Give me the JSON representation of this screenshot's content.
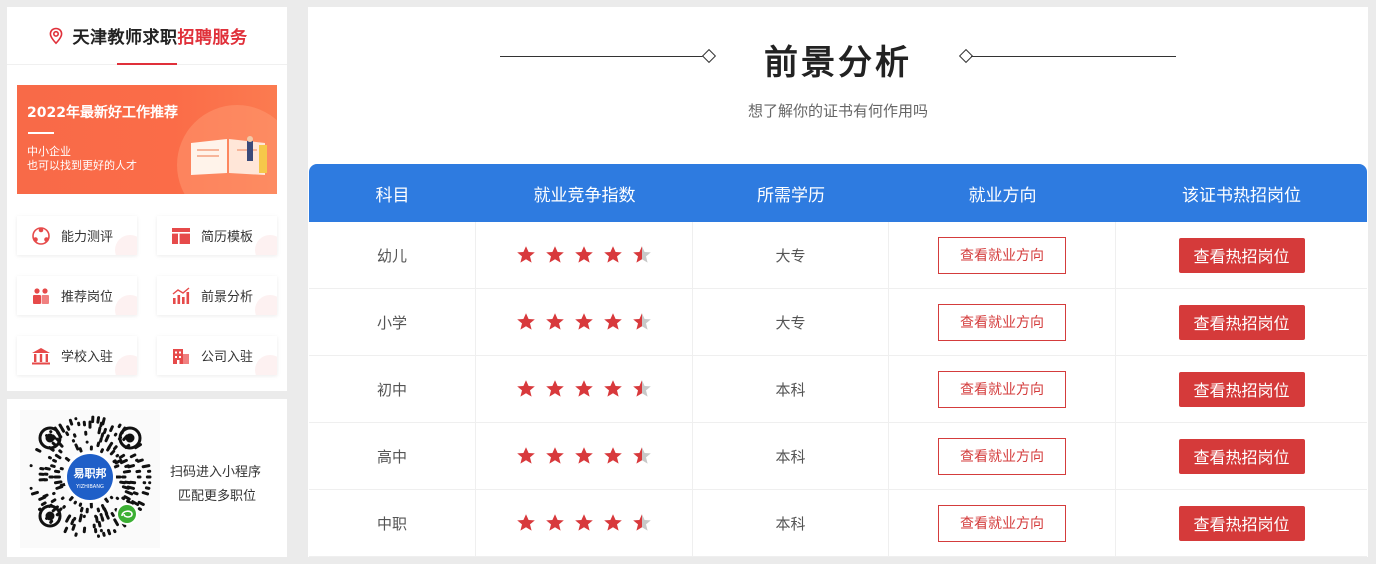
{
  "sidebar": {
    "title_main": "天津教师求职",
    "title_highlight": "招聘服务",
    "banner": {
      "title": "2022年最新好工作推荐",
      "sub1": "中小企业",
      "sub2": "也可以找到更好的人才"
    },
    "buttons": [
      {
        "label": "能力测评",
        "icon": "ability-test-icon"
      },
      {
        "label": "简历模板",
        "icon": "resume-template-icon"
      },
      {
        "label": "推荐岗位",
        "icon": "recommend-job-icon"
      },
      {
        "label": "前景分析",
        "icon": "prospect-chart-icon"
      },
      {
        "label": "学校入驻",
        "icon": "school-icon"
      },
      {
        "label": "公司入驻",
        "icon": "company-icon"
      }
    ],
    "qr": {
      "logo_text": "易职邦",
      "logo_sub": "YIZHIBANG",
      "line1": "扫码进入小程序",
      "line2": "匹配更多职位"
    }
  },
  "main": {
    "title": "前景分析",
    "subtitle": "想了解你的证书有何作用吗",
    "table": {
      "headers": [
        "科目",
        "就业竞争指数",
        "所需学历",
        "就业方向",
        "该证书热招岗位"
      ],
      "rows": [
        {
          "subject": "幼儿",
          "stars": 4.5,
          "education": "大专",
          "direction_btn": "查看就业方向",
          "jobs_btn": "查看热招岗位"
        },
        {
          "subject": "小学",
          "stars": 4.5,
          "education": "大专",
          "direction_btn": "查看就业方向",
          "jobs_btn": "查看热招岗位"
        },
        {
          "subject": "初中",
          "stars": 4.5,
          "education": "本科",
          "direction_btn": "查看就业方向",
          "jobs_btn": "查看热招岗位"
        },
        {
          "subject": "高中",
          "stars": 4.5,
          "education": "本科",
          "direction_btn": "查看就业方向",
          "jobs_btn": "查看热招岗位"
        },
        {
          "subject": "中职",
          "stars": 4.5,
          "education": "本科",
          "direction_btn": "查看就业方向",
          "jobs_btn": "查看热招岗位"
        }
      ]
    }
  },
  "colors": {
    "accent_red": "#e0303a",
    "header_blue": "#2e7be0",
    "button_red": "#d53a3a",
    "star_red": "#d8393c",
    "star_gray": "#c8c8c8"
  }
}
